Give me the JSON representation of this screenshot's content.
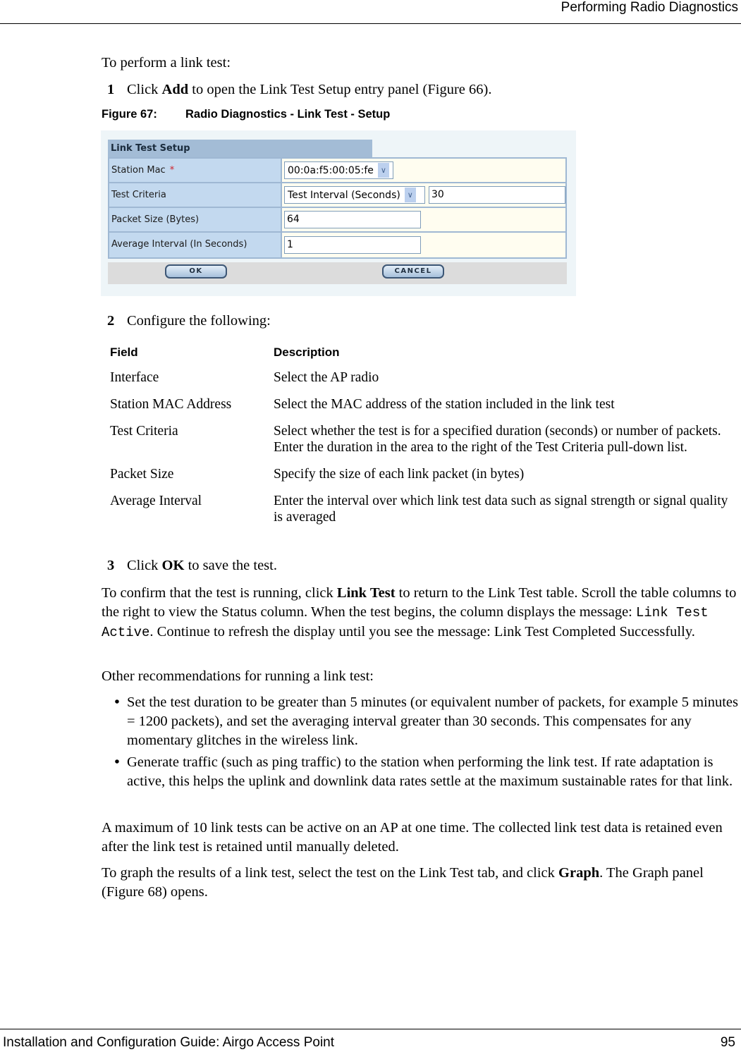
{
  "header": {
    "title": "Performing Radio Diagnostics"
  },
  "footer": {
    "guide_title": "Installation and Configuration Guide: Airgo Access Point",
    "page_number": "95"
  },
  "intro": "To perform a link test:",
  "step1": {
    "num": "1",
    "pre": "Click ",
    "bold": "Add",
    "post": " to open the Link Test Setup entry panel (Figure 66)."
  },
  "figure": {
    "number": "Figure 67:",
    "caption": "Radio Diagnostics - Link Test - Setup",
    "form": {
      "title": "Link Test Setup",
      "rows": [
        {
          "label": "Station Mac",
          "required_marker": "*",
          "select_value": "00:0a:f5:00:05:fe"
        },
        {
          "label": "Test Criteria",
          "select_value": "Test Interval (Seconds)",
          "input_value": "30"
        },
        {
          "label": "Packet Size (Bytes)",
          "input_value": "64"
        },
        {
          "label": "Average Interval (In Seconds)",
          "input_value": "1"
        }
      ],
      "ok_label": "OK",
      "cancel_label": "CANCEL",
      "dropdown_icon": "chevron-down-icon"
    }
  },
  "step2": {
    "num": "2",
    "text": "Configure the following:"
  },
  "table": {
    "headers": [
      "Field",
      "Description"
    ],
    "rows": [
      [
        "Interface",
        "Select the AP radio"
      ],
      [
        "Station MAC Address",
        "Select the MAC address of the station included in the link test"
      ],
      [
        "Test Criteria",
        "Select whether the test is for a specified duration (seconds) or number of packets. Enter the duration in the area to the right of the Test Criteria pull-down list."
      ],
      [
        "Packet Size",
        "Specify the size of each link packet (in bytes)"
      ],
      [
        "Average Interval",
        "Enter the interval over which link test data such as signal strength or signal quality is averaged"
      ]
    ]
  },
  "step3": {
    "num": "3",
    "pre": "Click ",
    "bold": "OK",
    "post": " to save the test."
  },
  "confirm": {
    "pre": "To confirm that the test is running, click ",
    "bold": "Link Test",
    "mid": " to return to the Link Test table. Scroll the table columns to the right to view the Status column. When the test begins, the column displays the message: ",
    "code": "Link Test Active",
    "post": ". Continue to refresh the display until you see the message: Link Test Completed Successfully."
  },
  "other_intro": "Other recommendations for running a link test:",
  "bullets": [
    "Set the test duration to be greater than 5 minutes (or equivalent number of packets, for example 5 minutes = 1200 packets), and set the averaging interval greater than 30 seconds. This compensates for any momentary glitches in the wireless link.",
    "Generate traffic (such as ping traffic) to the station when performing the link test. If rate adaptation is active, this helps the uplink and downlink data rates settle at the maximum sustainable rates for that link."
  ],
  "bullet_glyph": "•",
  "maximum_para": "A maximum of 10 link tests can be active on an AP at one time. The collected link test data is retained even after the link test is retained until manually deleted.",
  "graph_para": {
    "pre": "To graph the results of a link test, select the test on the Link Test tab, and click ",
    "bold": "Graph",
    "post": ". The Graph panel (Figure 68) opens."
  }
}
